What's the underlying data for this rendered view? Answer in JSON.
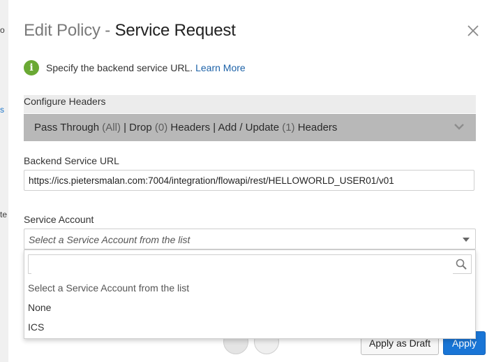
{
  "background": {
    "fragments": [
      "o",
      "s",
      "te"
    ]
  },
  "dialog": {
    "title_prefix": "Edit Policy",
    "title_separator": " - ",
    "title_main": "Service Request",
    "close_icon": "close-icon"
  },
  "info": {
    "icon": "info-icon",
    "icon_glyph": "i",
    "text": "Specify the backend service URL.",
    "link": "Learn More"
  },
  "configure_headers": {
    "label": "Configure Headers",
    "summary_parts": [
      {
        "text": "Pass Through "
      },
      {
        "text": "(All)"
      },
      {
        "text": " | Drop "
      },
      {
        "text": "(0)"
      },
      {
        "text": " Headers | Add / Update "
      },
      {
        "text": "(1)"
      },
      {
        "text": " Headers"
      }
    ]
  },
  "backend_url": {
    "label": "Backend Service URL",
    "value": "https://ics.pietersmalan.com:7004/integration/flowapi/rest/HELLOWORLD_USER01/v01"
  },
  "service_account": {
    "label": "Service Account",
    "placeholder": "Select a Service Account from the list",
    "search_value": "",
    "options": [
      "Select a Service Account from the list",
      "None",
      "ICS"
    ]
  },
  "footer": {
    "apply_draft_label": "Apply as Draft",
    "apply_label": "Apply"
  },
  "colors": {
    "accent": "#1975d6",
    "info_green": "#6aa934",
    "link": "#1d62a8"
  }
}
